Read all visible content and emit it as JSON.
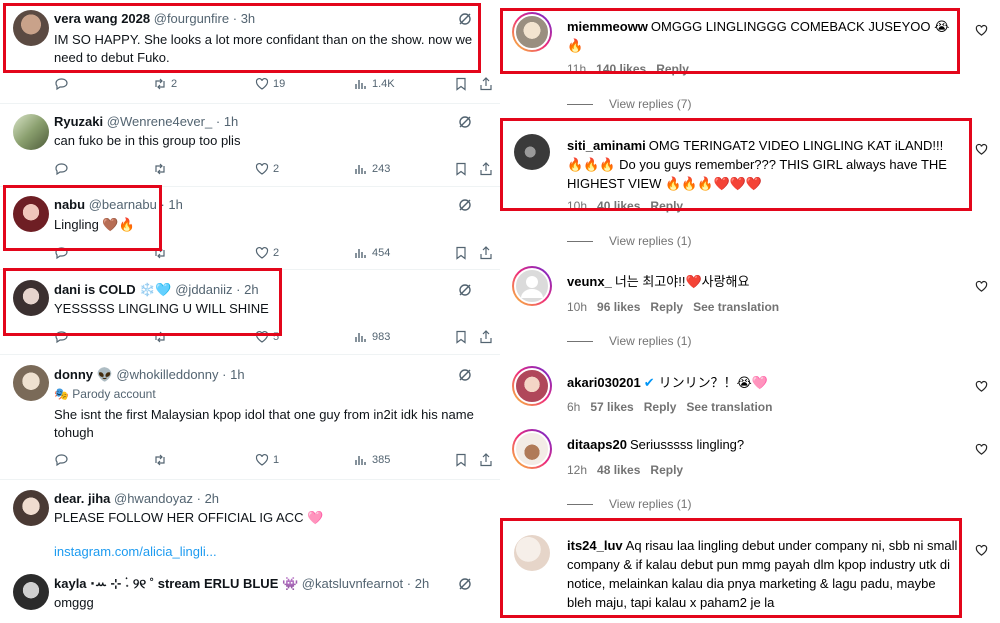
{
  "twitter": {
    "tweets": [
      {
        "name": "vera wang 2028",
        "handle": "@fourgunfire",
        "time": "3h",
        "body": "IM SO HAPPY. She looks a lot more confidant than on the show. now we need to debut Fuko.",
        "replies": "",
        "retweets": "2",
        "likes": "19",
        "views": "1.4K"
      },
      {
        "name": "Ryuzaki",
        "handle": "@Wenrene4ever_",
        "time": "1h",
        "body": "can fuko be in this group too plis",
        "replies": "",
        "retweets": "",
        "likes": "2",
        "views": "243"
      },
      {
        "name": "nabu",
        "handle": "@bearnabu",
        "time": "1h",
        "body": "Lingling 🤎🔥",
        "replies": "",
        "retweets": "",
        "likes": "2",
        "views": "454"
      },
      {
        "name": "dani is COLD ❄️🩵",
        "handle": "@jddaniiz",
        "time": "2h",
        "body": "YESSSSS LINGLING U WILL SHINE",
        "replies": "",
        "retweets": "",
        "likes": "5",
        "views": "983"
      },
      {
        "name": "donny 👽",
        "handle": "@whokilleddonny",
        "time": "1h",
        "parody": "Parody account",
        "body": "She isnt the first Malaysian kpop idol that one guy from in2it idk his name tohugh",
        "replies": "",
        "retweets": "",
        "likes": "1",
        "views": "385"
      },
      {
        "name": "dear. jiha",
        "handle": "@hwandoyaz",
        "time": "2h",
        "body": "PLEASE FOLLOW HER OFFICIAL IG ACC 🩷",
        "link": "instagram.com/alicia_lingli..."
      },
      {
        "name": "kayla ⋅ꕀ ⊹ ࣪˖ ୨୧ ˚ stream ERLU BLUE 👾",
        "handle": "@katsluvnfearnot",
        "time": "2h",
        "body": "omggg"
      }
    ]
  },
  "instagram": {
    "comments": [
      {
        "user": "miemmeoww",
        "text": "OMGGG LINGLINGGG COMEBACK JUSEYOO 😭🔥",
        "time": "11h",
        "likes": "140 likes",
        "reply": "Reply",
        "view_replies": "View replies (7)"
      },
      {
        "user": "siti_aminami",
        "text": "OMG TERINGAT2 VIDEO LINGLING KAT iLAND!!! 🔥🔥🔥 Do you guys remember??? THIS GIRL always have THE HIGHEST VIEW 🔥🔥🔥❤️❤️❤️",
        "time": "10h",
        "likes": "40 likes",
        "reply": "Reply",
        "view_replies": "View replies (1)"
      },
      {
        "user": "veunx_",
        "text": "너는 최고야!!❤️사랑해요",
        "time": "10h",
        "likes": "96 likes",
        "reply": "Reply",
        "translate": "See translation",
        "view_replies": "View replies (1)"
      },
      {
        "user": "akari030201",
        "text": "リンリン？！😭🩷",
        "time": "6h",
        "likes": "57 likes",
        "reply": "Reply",
        "translate": "See translation"
      },
      {
        "user": "ditaaps20",
        "text": "Seriusssss lingling?",
        "time": "12h",
        "likes": "48 likes",
        "reply": "Reply",
        "view_replies": "View replies (1)"
      },
      {
        "user": "its24_luv",
        "text": "Aq risau laa lingling debut under company ni, sbb ni small company & if kalau debut pun mmg payah dlm kpop industry utk di notice, melainkan kalau dia pnya marketing & lagu padu, maybe bleh maju, tapi kalau x paham2 je la"
      }
    ]
  },
  "colors": {
    "highlight": "#e3061b",
    "link": "#1d9bf0",
    "muted": "#536471",
    "ig_muted": "#737373"
  }
}
